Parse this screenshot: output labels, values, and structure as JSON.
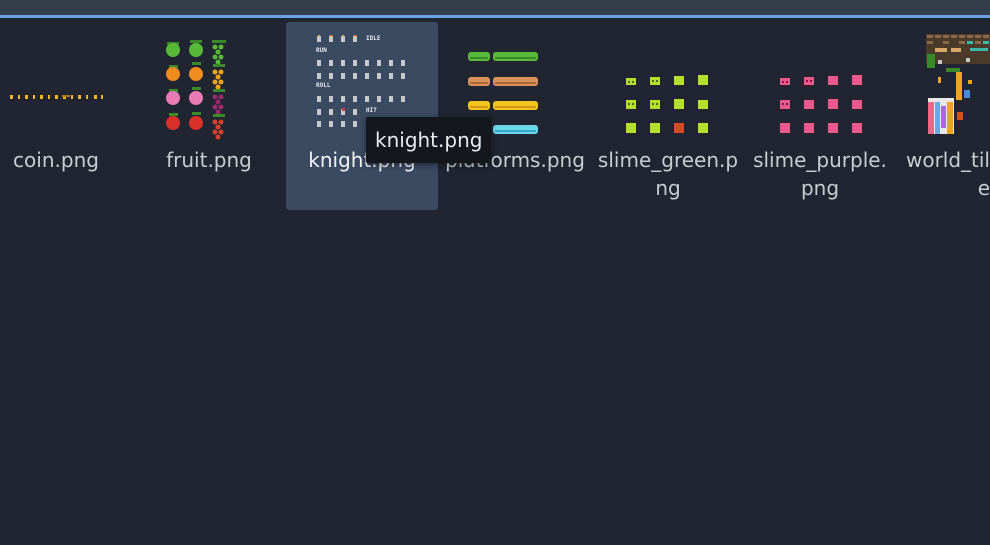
{
  "window": {
    "accent_color": "#6aa3e6",
    "background": "#202531"
  },
  "files": [
    {
      "name": "coin.png",
      "label_line1": "coin.png",
      "label_line2": "",
      "selected": false,
      "icon": "coin-sprite-icon"
    },
    {
      "name": "fruit.png",
      "label_line1": "fruit.png",
      "label_line2": "",
      "selected": false,
      "icon": "fruit-sprite-icon"
    },
    {
      "name": "knight.png",
      "label_line1": "knight.png",
      "label_line2": "",
      "selected": true,
      "icon": "knight-sprite-icon"
    },
    {
      "name": "platforms.png",
      "label_line1": "platforms.png",
      "label_line2": "",
      "selected": false,
      "icon": "platforms-sprite-icon"
    },
    {
      "name": "slime_green.png",
      "label_line1": "slime_green.p",
      "label_line2": "ng",
      "selected": false,
      "icon": "slime-green-sprite-icon"
    },
    {
      "name": "slime_purple.png",
      "label_line1": "slime_purple.",
      "label_line2": "png",
      "selected": false,
      "icon": "slime-purple-sprite-icon"
    },
    {
      "name": "world_tileset.png",
      "label_line1": "world_tile",
      "label_line2": "ng",
      "selected": false,
      "icon": "world-tileset-sprite-icon"
    }
  ],
  "thumb_text": {
    "idle": "IDLE",
    "run": "RUN",
    "roll": "ROLL",
    "hit": "HIT"
  },
  "tooltip": {
    "text": "knight.png"
  }
}
